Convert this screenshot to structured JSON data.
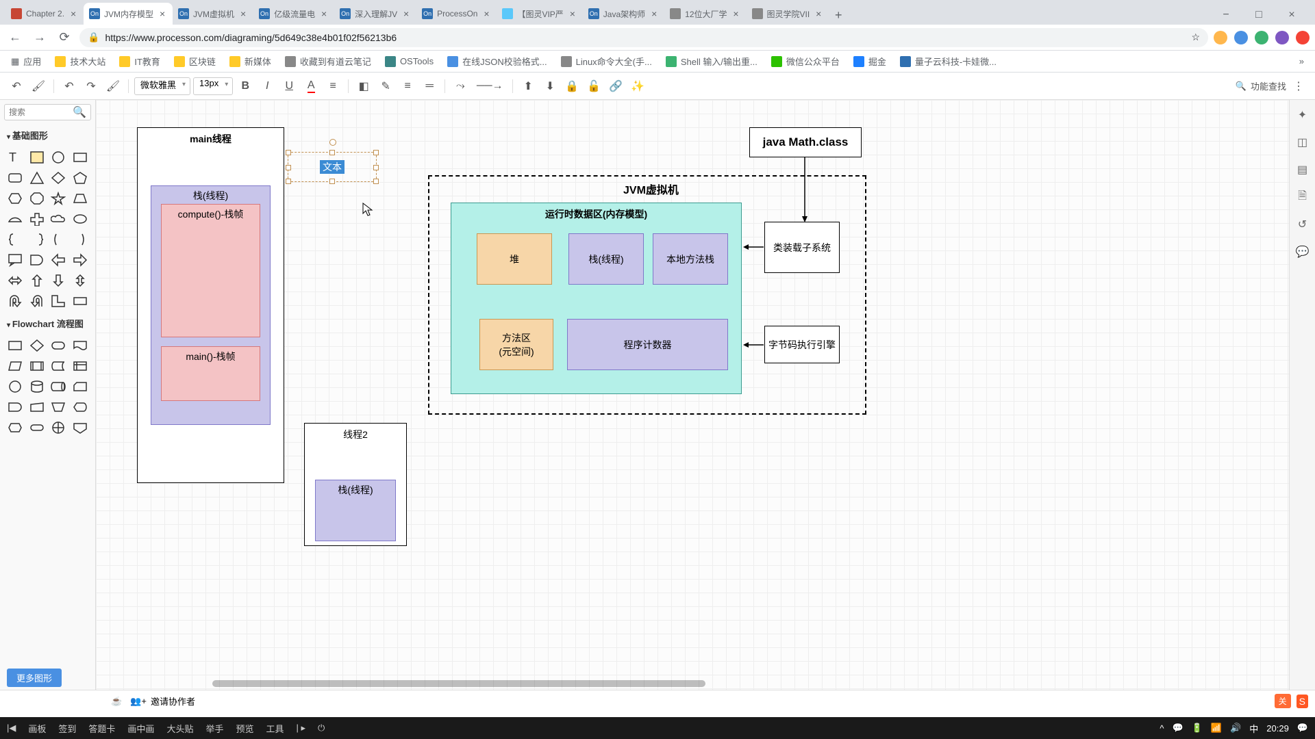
{
  "browser": {
    "tabs": [
      {
        "title": "Chapter 2.",
        "favicon": "#c74634"
      },
      {
        "title": "JVM内存模型",
        "favicon": "#2f6fb0",
        "active": true
      },
      {
        "title": "JVM虚拟机",
        "favicon": "#2f6fb0"
      },
      {
        "title": "亿级流量电",
        "favicon": "#2f6fb0"
      },
      {
        "title": "深入理解JV",
        "favicon": "#2f6fb0"
      },
      {
        "title": "ProcessOn",
        "favicon": "#2f6fb0"
      },
      {
        "title": "【图灵VIP严",
        "favicon": "#5ac8fa"
      },
      {
        "title": "Java架构师",
        "favicon": "#2f6fb0"
      },
      {
        "title": "12位大厂学",
        "favicon": "#888"
      },
      {
        "title": "图灵学院VII",
        "favicon": "#888"
      }
    ],
    "url": "https://www.processon.com/diagraming/5d649c38e4b01f02f56213b6",
    "bookmarks": [
      {
        "label": "应用",
        "type": "apps"
      },
      {
        "label": "技术大站",
        "type": "folder"
      },
      {
        "label": "IT教育",
        "type": "folder"
      },
      {
        "label": "区块链",
        "type": "folder"
      },
      {
        "label": "新媒体",
        "type": "folder"
      },
      {
        "label": "收藏到有道云笔记",
        "type": "site",
        "color": "#888"
      },
      {
        "label": "OSTools",
        "type": "site",
        "color": "#3b8686"
      },
      {
        "label": "在线JSON校验格式...",
        "type": "site",
        "color": "#4a90e2"
      },
      {
        "label": "Linux命令大全(手...",
        "type": "site",
        "color": "#888"
      },
      {
        "label": "Shell 输入/输出重...",
        "type": "site",
        "color": "#3cb371"
      },
      {
        "label": "微信公众平台",
        "type": "site",
        "color": "#2dc100"
      },
      {
        "label": "掘金",
        "type": "site",
        "color": "#1e80ff"
      },
      {
        "label": "量子云科技-卡娃微...",
        "type": "site",
        "color": "#2f6fb0"
      }
    ]
  },
  "toolbar": {
    "font": "微软雅黑",
    "size": "13px",
    "search_label": "功能查找"
  },
  "sidebar": {
    "search_placeholder": "搜索",
    "cat_basic": "基础图形",
    "cat_flowchart": "Flowchart 流程图",
    "more_shapes": "更多图形"
  },
  "diagram": {
    "main_thread": "main线程",
    "stack_thread": "栈(线程)",
    "compute_frame": "compute()-栈帧",
    "main_frame": "main()-栈帧",
    "text_placeholder": "文本",
    "thread2": "线程2",
    "stack_thread2": "栈(线程)",
    "jvm": "JVM虚拟机",
    "runtime_data": "运行时数据区(内存模型)",
    "heap": "堆",
    "stack": "栈(线程)",
    "native_stack": "本地方法栈",
    "method_area_1": "方法区",
    "method_area_2": "(元空间)",
    "pc_register": "程序计数器",
    "class_loader": "类装载子系统",
    "exec_engine": "字节码执行引擎",
    "math_class": "java Math.class"
  },
  "bottombar": {
    "invite": "邀请协作者"
  },
  "taskbar": {
    "items": [
      "画板",
      "签到",
      "答题卡",
      "画中画",
      "大头贴",
      "举手",
      "预览",
      "工具"
    ],
    "time": "20:29"
  }
}
